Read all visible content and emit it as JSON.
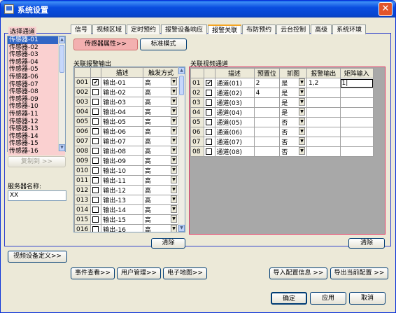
{
  "window": {
    "title": "系统设置",
    "close_glyph": "✕"
  },
  "tabs": [
    "信号",
    "视频区域",
    "定时预约",
    "报警设备响应",
    "报警关联",
    "布防预约",
    "云台控制",
    "高级",
    "系统环境"
  ],
  "active_tab": "报警关联",
  "left": {
    "select_channel_label": "选择通道",
    "channels": [
      "传感器-01",
      "传感器-02",
      "传感器-03",
      "传感器-04",
      "传感器-05",
      "传感器-06",
      "传感器-07",
      "传感器-08",
      "传感器-09",
      "传感器-10",
      "传感器-11",
      "传感器-12",
      "传感器-13",
      "传感器-14",
      "传感器-15",
      "传感器-16"
    ],
    "copy_to_label": "复制到 >>",
    "server_name_label": "服务器名称:",
    "server_name_value": "XX",
    "video_device_def_label": "视频设备定义>>"
  },
  "mode_buttons": {
    "sensor_attr": "传感器属性>>",
    "standard_mode": "标准模式"
  },
  "alarm_output": {
    "title": "关联报警输出",
    "headers": [
      "",
      "",
      "描述",
      "触发方式"
    ],
    "rows": [
      {
        "id": "001",
        "checked": true,
        "desc": "输出-01",
        "mode": "高"
      },
      {
        "id": "002",
        "checked": false,
        "desc": "输出-02",
        "mode": "高"
      },
      {
        "id": "003",
        "checked": false,
        "desc": "输出-03",
        "mode": "高"
      },
      {
        "id": "004",
        "checked": false,
        "desc": "输出-04",
        "mode": "高"
      },
      {
        "id": "005",
        "checked": false,
        "desc": "输出-05",
        "mode": "高"
      },
      {
        "id": "006",
        "checked": false,
        "desc": "输出-06",
        "mode": "高"
      },
      {
        "id": "007",
        "checked": false,
        "desc": "输出-07",
        "mode": "高"
      },
      {
        "id": "008",
        "checked": false,
        "desc": "输出-08",
        "mode": "高"
      },
      {
        "id": "009",
        "checked": false,
        "desc": "输出-09",
        "mode": "高"
      },
      {
        "id": "010",
        "checked": false,
        "desc": "输出-10",
        "mode": "高"
      },
      {
        "id": "011",
        "checked": false,
        "desc": "输出-11",
        "mode": "高"
      },
      {
        "id": "012",
        "checked": false,
        "desc": "输出-12",
        "mode": "高"
      },
      {
        "id": "013",
        "checked": false,
        "desc": "输出-13",
        "mode": "高"
      },
      {
        "id": "014",
        "checked": false,
        "desc": "输出-14",
        "mode": "高"
      },
      {
        "id": "015",
        "checked": false,
        "desc": "输出-15",
        "mode": "高"
      },
      {
        "id": "016",
        "checked": false,
        "desc": "输出-16",
        "mode": "高"
      }
    ],
    "clear_label": "清除"
  },
  "video_channel": {
    "title": "关联视频通道",
    "headers": [
      "",
      "",
      "描述",
      "预置位",
      "抓图",
      "报警输出",
      "矩阵输入"
    ],
    "rows": [
      {
        "id": "01",
        "checked": true,
        "desc": "通道(01)",
        "preset": "2",
        "capture": "是",
        "alarm_out": "1,2",
        "matrix": "1|"
      },
      {
        "id": "02",
        "checked": false,
        "desc": "通道(02)",
        "preset": "4",
        "capture": "是",
        "alarm_out": "",
        "matrix": ""
      },
      {
        "id": "03",
        "checked": false,
        "desc": "通道(03)",
        "preset": "",
        "capture": "是",
        "alarm_out": "",
        "matrix": ""
      },
      {
        "id": "04",
        "checked": false,
        "desc": "通道(04)",
        "preset": "",
        "capture": "是",
        "alarm_out": "",
        "matrix": ""
      },
      {
        "id": "05",
        "checked": false,
        "desc": "通道(05)",
        "preset": "",
        "capture": "否",
        "alarm_out": "",
        "matrix": ""
      },
      {
        "id": "06",
        "checked": false,
        "desc": "通道(06)",
        "preset": "",
        "capture": "否",
        "alarm_out": "",
        "matrix": ""
      },
      {
        "id": "07",
        "checked": false,
        "desc": "通道(07)",
        "preset": "",
        "capture": "否",
        "alarm_out": "",
        "matrix": ""
      },
      {
        "id": "08",
        "checked": false,
        "desc": "通道(08)",
        "preset": "",
        "capture": "否",
        "alarm_out": "",
        "matrix": ""
      }
    ],
    "clear_label": "清除"
  },
  "bottom_bar": {
    "event_view": "事件查看>>",
    "user_mgmt": "用户管理>>",
    "emap": "电子地图>>",
    "import_config": "导入配置信息 >>",
    "export_config": "导出当前配置 >>"
  },
  "footer": {
    "ok": "确定",
    "apply": "应用",
    "cancel": "取消"
  },
  "colors": {
    "titlebar": "#0a4ee0",
    "highlight_pink": "#fad0d0",
    "selection": "#3166c5",
    "panel_border": "#3344cc",
    "red_border": "#e03a6a"
  }
}
